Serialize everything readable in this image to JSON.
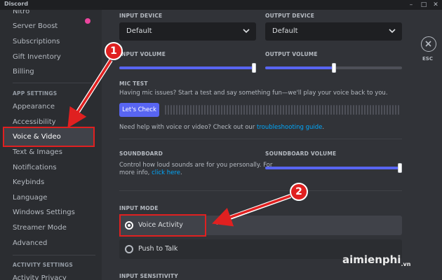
{
  "window": {
    "title": "Discord"
  },
  "sidebar": {
    "items_top": [
      {
        "label": "Nitro"
      },
      {
        "label": "Server Boost"
      },
      {
        "label": "Subscriptions"
      },
      {
        "label": "Gift Inventory"
      },
      {
        "label": "Billing"
      }
    ],
    "app_settings_header": "APP SETTINGS",
    "app_items": [
      {
        "label": "Appearance"
      },
      {
        "label": "Accessibility"
      },
      {
        "label": "Voice & Video"
      },
      {
        "label": "Text & Images"
      },
      {
        "label": "Notifications"
      },
      {
        "label": "Keybinds"
      },
      {
        "label": "Language"
      },
      {
        "label": "Windows Settings"
      },
      {
        "label": "Streamer Mode"
      },
      {
        "label": "Advanced"
      }
    ],
    "activity_settings_header": "ACTIVITY SETTINGS",
    "activity_items": [
      {
        "label": "Activity Privacy"
      }
    ]
  },
  "content": {
    "input_device": {
      "label": "INPUT DEVICE",
      "value": "Default"
    },
    "output_device": {
      "label": "OUTPUT DEVICE",
      "value": "Default"
    },
    "input_volume": {
      "label": "INPUT VOLUME",
      "level": 1.0
    },
    "output_volume": {
      "label": "OUTPUT VOLUME",
      "level": 0.5
    },
    "mic_test": {
      "label": "MIC TEST",
      "description": "Having mic issues? Start a test and say something fun—we'll play your voice back to you.",
      "button": "Let's Check"
    },
    "help": {
      "text": "Need help with voice or video? Check out our ",
      "link": "troubleshooting guide",
      "suffix": "."
    },
    "soundboard": {
      "label": "SOUNDBOARD",
      "description_line1": "Control how loud sounds are for you personally. For",
      "description_line2": "more info, ",
      "link": "click here",
      "suffix": "."
    },
    "soundboard_volume": {
      "label": "SOUNDBOARD VOLUME",
      "level": 1.0
    },
    "input_mode": {
      "label": "INPUT MODE",
      "options": [
        {
          "label": "Voice Activity",
          "selected": true
        },
        {
          "label": "Push to Talk",
          "selected": false
        }
      ]
    },
    "input_sensitivity": {
      "label": "INPUT SENSITIVITY"
    },
    "esc": {
      "label": "ESC"
    }
  },
  "annotations": {
    "badge1": "1",
    "badge2": "2",
    "highlight_color": "#e02020"
  },
  "watermark": {
    "text": "aimienphi",
    "sub": ".vn"
  },
  "colors": {
    "accent": "#5865f2",
    "link": "#00a8fc",
    "bg": "#313338",
    "sidebar": "#2b2d31"
  }
}
